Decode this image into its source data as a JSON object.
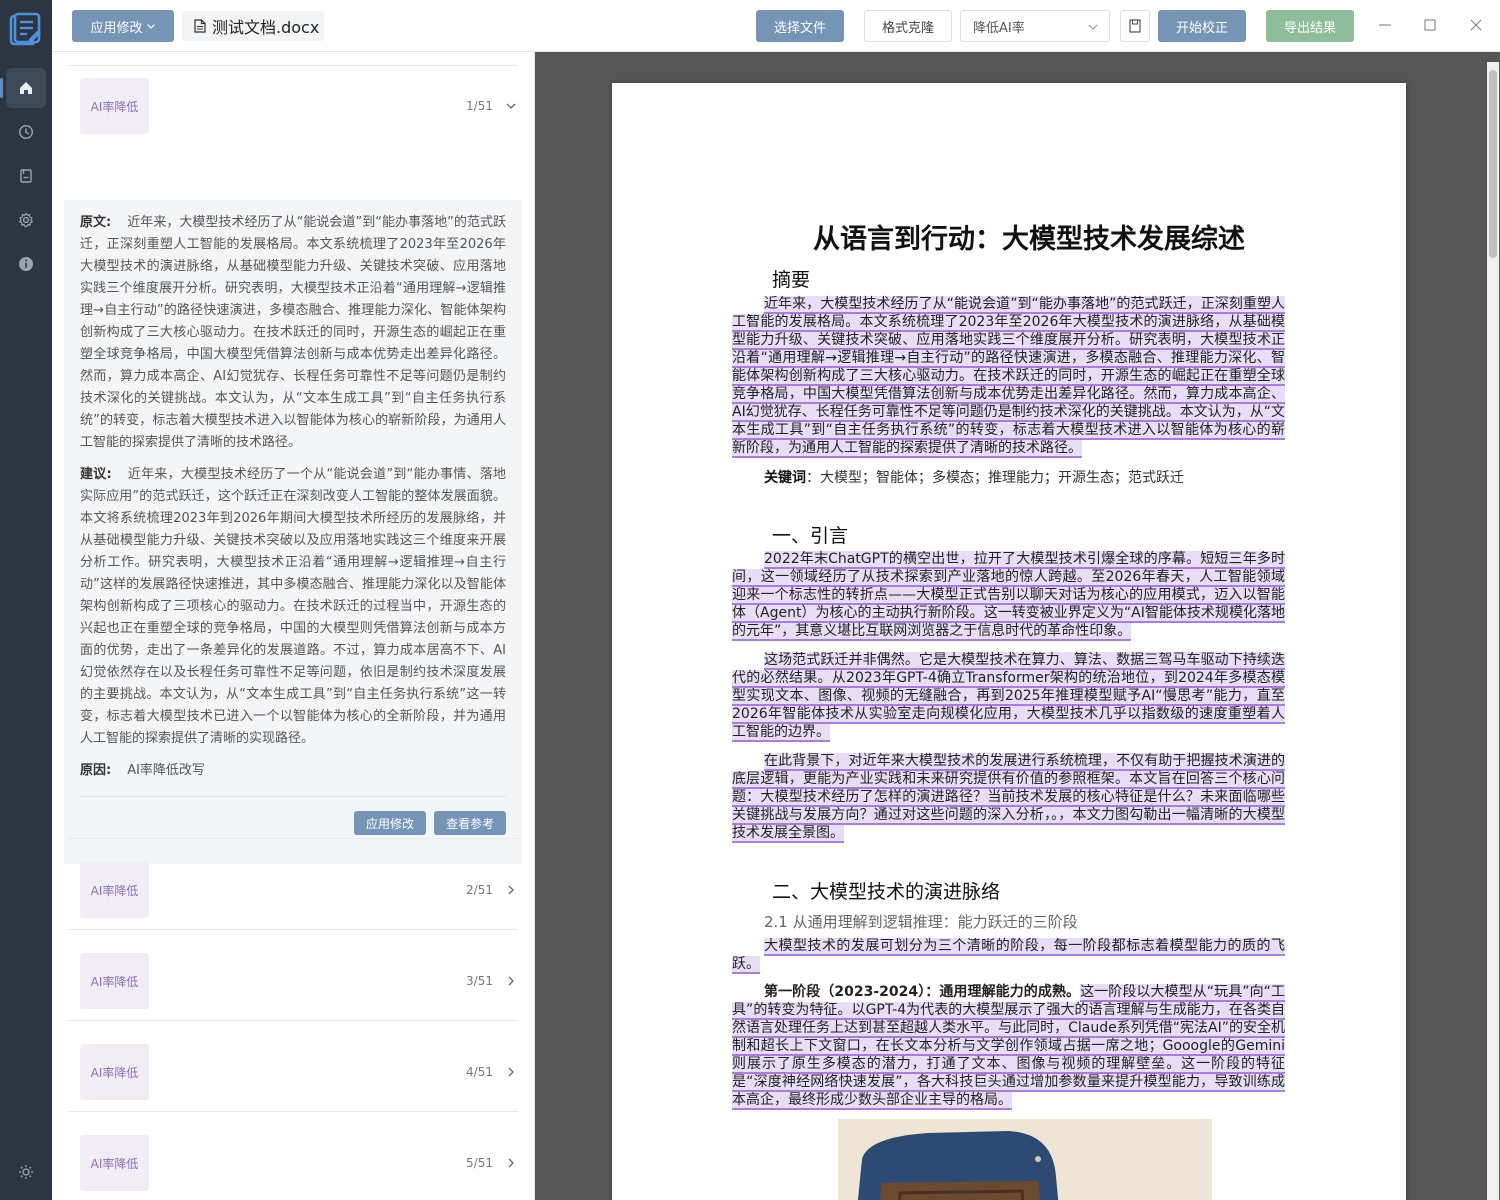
{
  "rail": {
    "items": [
      "home-icon",
      "history-icon",
      "book-icon",
      "settings-icon",
      "info-icon"
    ],
    "bottom": "theme-icon"
  },
  "topbar": {
    "apply_label": "应用修改",
    "file_name": "测试文档.docx",
    "choose_file": "选择文件",
    "format_brush": "格式克隆",
    "mode_selected": "降低AI率",
    "start_label": "开始校正",
    "export_label": "导出结果"
  },
  "panel": {
    "items": [
      {
        "badge": "AI率降低",
        "count": "1/51"
      },
      {
        "badge": "AI率降低",
        "count": "2/51"
      },
      {
        "badge": "AI率降低",
        "count": "3/51"
      },
      {
        "badge": "AI率降低",
        "count": "4/51"
      },
      {
        "badge": "AI率降低",
        "count": "5/51"
      }
    ],
    "detail": {
      "original_label": "原文:",
      "original": "近年来，大模型技术经历了从“能说会道”到“能办事落地”的范式跃迁，正深刻重塑人工智能的发展格局。本文系统梳理了2023年至2026年大模型技术的演进脉络，从基础模型能力升级、关键技术突破、应用落地实践三个维度展开分析。研究表明，大模型技术正沿着“通用理解→逻辑推理→自主行动”的路径快速演进，多模态融合、推理能力深化、智能体架构创新构成了三大核心驱动力。在技术跃迁的同时，开源生态的崛起正在重塑全球竞争格局，中国大模型凭借算法创新与成本优势走出差异化路径。然而，算力成本高企、AI幻觉犹存、长程任务可靠性不足等问题仍是制约技术深化的关键挑战。本文认为，从“文本生成工具”到“自主任务执行系统”的转变，标志着大模型技术进入以智能体为核心的崭新阶段，为通用人工智能的探索提供了清晰的技术路径。",
      "suggest_label": "建议:",
      "suggest": "近年来，大模型技术经历了一个从“能说会道”到“能办事情、落地实际应用”的范式跃迁，这个跃迁正在深刻改变人工智能的整体发展面貌。本文将系统梳理2023年到2026年期间大模型技术所经历的发展脉络，并从基础模型能力升级、关键技术突破以及应用落地实践这三个维度来开展分析工作。研究表明，大模型技术正沿着“通用理解→逻辑推理→自主行动”这样的发展路径快速推进，其中多模态融合、推理能力深化以及智能体架构创新构成了三项核心的驱动力。在技术跃迁的过程当中，开源生态的兴起也正在重塑全球的竞争格局，中国的大模型则凭借算法创新与成本方面的优势，走出了一条差异化的发展道路。不过，算力成本居高不下、AI幻觉依然存在以及长程任务可靠性不足等问题，依旧是制约技术深度发展的主要挑战。本文认为，从“文本生成工具”到“自主任务执行系统”这一转变，标志着大模型技术已进入一个以智能体为核心的全新阶段，并为通用人工智能的探索提供了清晰的实现路径。",
      "reason_label": "原因:",
      "reason": "AI率降低改写",
      "apply_btn": "应用修改",
      "ref_btn": "查看参考"
    }
  },
  "doc": {
    "title": "从语言到行动：大模型技术发展综述",
    "abstract_heading": "摘要",
    "abstract": "近年来，大模型技术经历了从“能说会道”到“能办事落地”的范式跃迁，正深刻重塑人工智能的发展格局。本文系统梳理了2023年至2026年大模型技术的演进脉络，从基础模型能力升级、关键技术突破、应用落地实践三个维度展开分析。研究表明，大模型技术正沿着“通用理解→逻辑推理→自主行动”的路径快速演进，多模态融合、推理能力深化、智能体架构创新构成了三大核心驱动力。在技术跃迁的同时，开源生态的崛起正在重塑全球竞争格局，中国大模型凭借算法创新与成本优势走出差异化路径。然而，算力成本高企、AI幻觉犹存、长程任务可靠性不足等问题仍是制约技术深化的关键挑战。本文认为，从“文本生成工具”到“自主任务执行系统”的转变，标志着大模型技术进入以智能体为核心的崭新阶段，为通用人工智能的探索提供了清晰的技术路径。",
    "keywords_label": "关键词",
    "keywords": "：大模型；智能体；多模态；推理能力；开源生态；范式跃迁",
    "section1": "一、引言",
    "p1": "2022年末ChatGPT的横空出世，拉开了大模型技术引爆全球的序幕。短短三年多时间，这一领域经历了从技术探索到产业落地的惊人跨越。至2026年春天，人工智能领域迎来一个标志性的转折点——大模型正式告别以聊天对话为核心的应用模式，迈入以智能体（Agent）为核心的主动执行新阶段。这一转变被业界定义为“AI智能体技术规模化落地的元年”，其意义堪比互联网浏览器之于信息时代的革命性印象。",
    "p2": "这场范式跃迁并非偶然。它是大模型技术在算力、算法、数据三驾马车驱动下持续迭代的必然结果。从2023年GPT-4确立Transformer架构的统治地位，到2024年多模态模型实现文本、图像、视频的无缝融合，再到2025年推理模型赋予AI“慢思考”能力，直至2026年智能体技术从实验室走向规模化应用，大模型技术几乎以指数级的速度重塑着人工智能的边界。",
    "p3": "在此背景下，对近年来大模型技术的发展进行系统梳理，不仅有助于把握技术演进的底层逻辑，更能为产业实践和未来研究提供有价值的参照框架。本文旨在回答三个核心问题：大模型技术经历了怎样的演进路径？当前技术发展的核心特征是什么？未来面临哪些关键挑战与发展方向？通过对这些问题的深入分析，。，本文力图勾勒出一幅清晰的大模型技术发展全景图。",
    "section2": "二、大模型技术的演进脉络",
    "sub21": "2.1 从通用理解到逻辑推理：能力跃迁的三阶段",
    "p4": "大模型技术的发展可划分为三个清晰的阶段，每一阶段都标志着模型能力的质的飞跃。",
    "p5_bold": "第一阶段（2023-2024）：通用理解能力的成熟。",
    "p5": "这一阶段以大模型从“玩具”向“工具”的转变为特征。以GPT-4为代表的大模型展示了强大的语言理解与生成能力，在各类自然语言处理任务上达到甚至超越人类水平。与此同时，Claude系列凭借“宪法AI”的安全机制和超长上下文窗口，在长文本分析与文学创作领域占据一席之地；Gooogle的Gemini则展示了原生多模态的潜力，打通了文本、图像与视频的理解壁垒。这一阶段的特征是“深度神经网络快速发展”，各大科技巨头通过增加参数量来提升模型能力，导致训练成本高企，最终形成少数头部企业主导的格局。"
  }
}
